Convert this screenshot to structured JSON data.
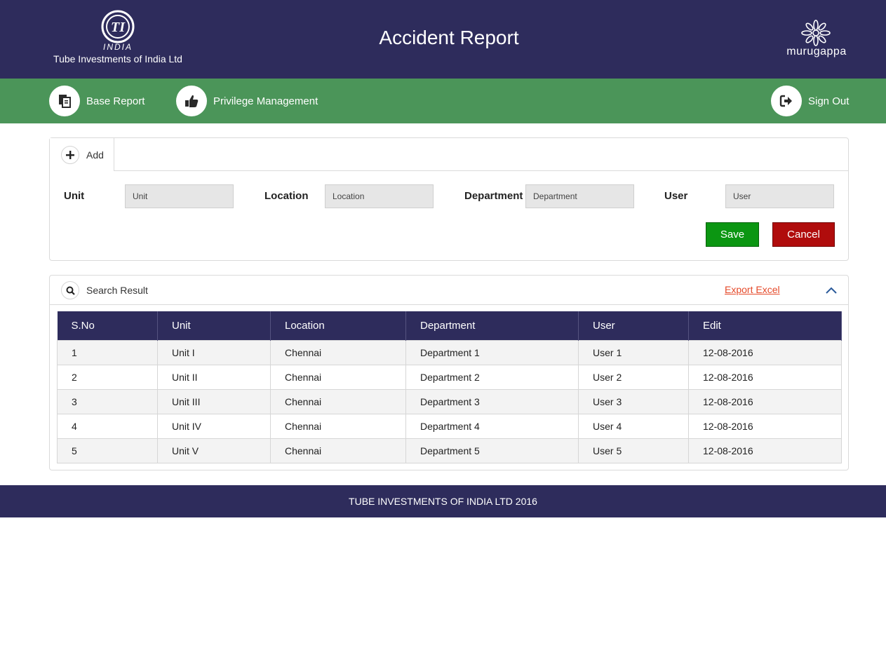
{
  "header": {
    "brand_mark": "TI",
    "brand_country": "INDIA",
    "company_name": "Tube Investments of India Ltd",
    "page_title": "Accident Report",
    "partner_logo_text": "murugappa"
  },
  "nav": {
    "items": [
      {
        "label": "Base Report",
        "icon": "document-copy-icon"
      },
      {
        "label": "Privilege Management",
        "icon": "thumbs-up-icon"
      }
    ],
    "sign_out": {
      "label": "Sign Out",
      "icon": "sign-out-icon"
    }
  },
  "add_panel": {
    "tab_label": "Add",
    "fields": [
      {
        "label": "Unit",
        "placeholder": "Unit"
      },
      {
        "label": "Location",
        "placeholder": "Location"
      },
      {
        "label": "Department",
        "placeholder": "Department"
      },
      {
        "label": "User",
        "placeholder": "User"
      }
    ],
    "save_label": "Save",
    "cancel_label": "Cancel"
  },
  "results": {
    "title": "Search Result",
    "export_label": "Export Excel",
    "columns": [
      "S.No",
      "Unit",
      "Location",
      "Department",
      "User",
      "Edit"
    ],
    "rows": [
      [
        "1",
        "Unit I",
        "Chennai",
        "Department 1",
        "User 1",
        "12-08-2016"
      ],
      [
        "2",
        "Unit II",
        "Chennai",
        "Department 2",
        "User 2",
        "12-08-2016"
      ],
      [
        "3",
        "Unit III",
        "Chennai",
        "Department 3",
        "User 3",
        "12-08-2016"
      ],
      [
        "4",
        "Unit IV",
        "Chennai",
        "Department 4",
        "User 4",
        "12-08-2016"
      ],
      [
        "5",
        "Unit V",
        "Chennai",
        "Department 5",
        "User 5",
        "12-08-2016"
      ]
    ]
  },
  "footer": {
    "text": "TUBE INVESTMENTS OF INDIA LTD 2016"
  },
  "colors": {
    "header_bg": "#2e2c5c",
    "nav_bg": "#4b9559",
    "save": "#0b9612",
    "cancel": "#b00c0c",
    "export_link": "#e54a2a"
  }
}
